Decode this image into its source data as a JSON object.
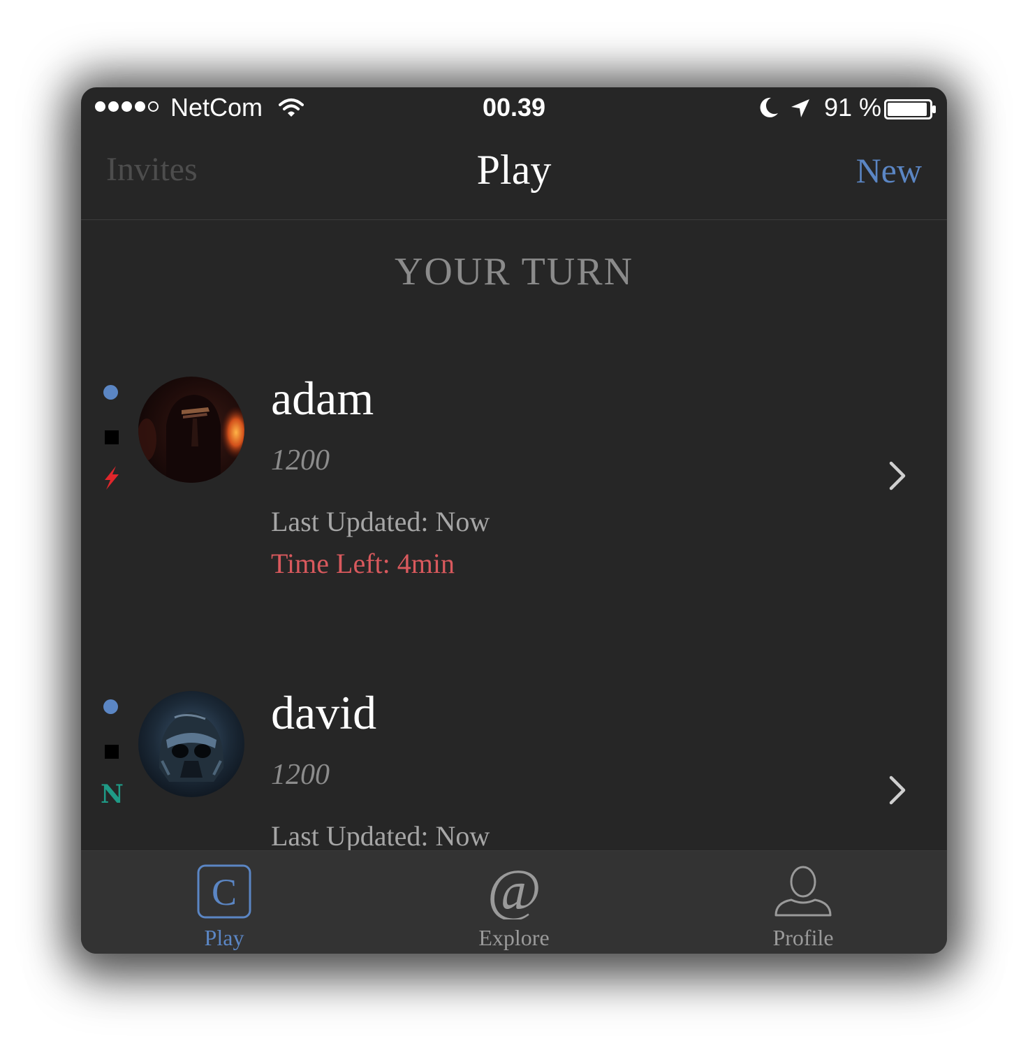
{
  "status_bar": {
    "signal_bars": [
      true,
      true,
      true,
      true,
      false
    ],
    "carrier": "NetCom",
    "time": "00.39",
    "battery_percent": "91 %",
    "icons": [
      "wifi-icon",
      "moon-icon",
      "location-arrow-icon",
      "battery-icon"
    ]
  },
  "nav": {
    "left_label": "Invites",
    "title": "Play",
    "right_label": "New"
  },
  "section": {
    "header": "YOUR TURN"
  },
  "games": [
    {
      "name": "adam",
      "rating": "1200",
      "last_updated": "Last Updated: Now",
      "time_left": "Time Left: 4min",
      "indicator_icons": [
        "turn-dot-icon",
        "black-piece-icon",
        "lightning-bolt-icon"
      ]
    },
    {
      "name": "david",
      "rating": "1200",
      "last_updated": "Last Updated: Now",
      "indicator_letter": "N",
      "indicator_icons": [
        "turn-dot-icon",
        "black-piece-icon",
        "normal-speed-icon"
      ]
    }
  ],
  "tabs": [
    {
      "label": "Play",
      "icon": "play-c-icon",
      "active": true
    },
    {
      "label": "Explore",
      "icon": "at-sign-icon",
      "active": false
    },
    {
      "label": "Profile",
      "icon": "person-icon",
      "active": false
    }
  ],
  "colors": {
    "background": "#262626",
    "accent_blue": "#5b86c4",
    "warning_red": "#d9595d",
    "teal": "#1f9a86",
    "tab_bar": "#333333"
  }
}
